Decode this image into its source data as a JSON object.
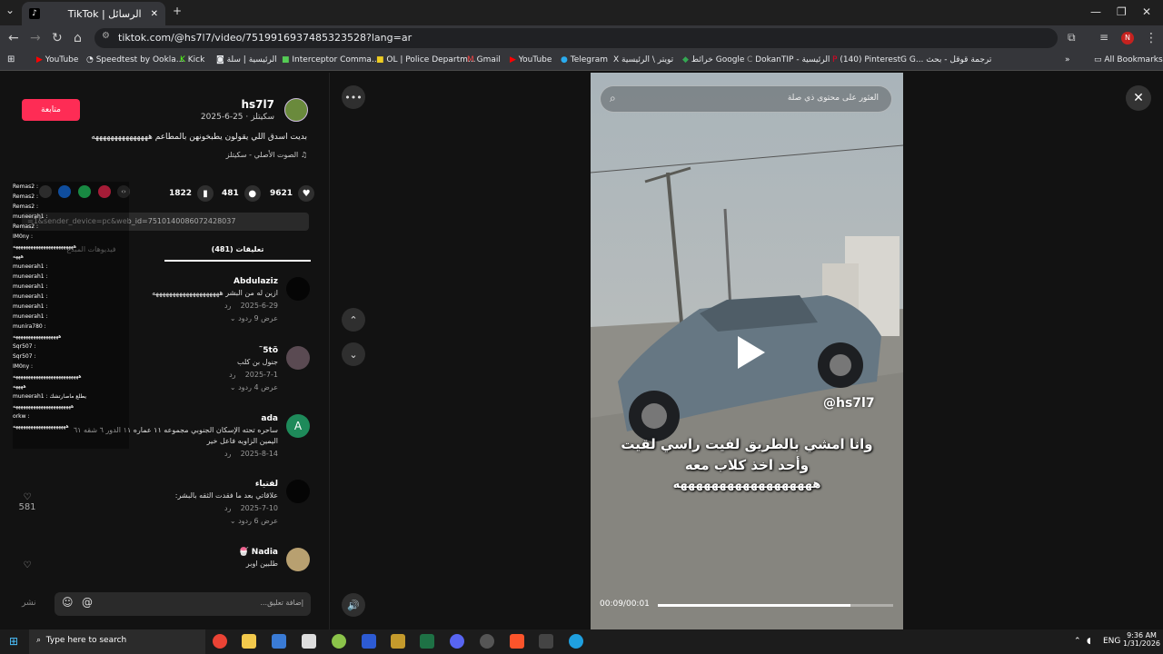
{
  "browser": {
    "tab_title": "TikTok | الرسائل",
    "url": "tiktok.com/@hs7l7/video/7519916937485323528?lang=ar",
    "bookmarks": [
      "YouTube",
      "Speedtest by Ookla...",
      "Kick",
      "الرئيسية | سلة",
      "Interceptor Comma...",
      "OL | Police Departm...",
      "Gmail",
      "YouTube",
      "Telegram",
      "تويتر \\ الرئيسية",
      "خرائط Google",
      "DokanTIP - الرئيسية",
      "(140) Pinterest",
      "G... ترجمة قوقل - بحث"
    ],
    "all_bookmarks": "All Bookmarks",
    "profile_initial": "N"
  },
  "post": {
    "follow_label": "متابعة",
    "username": "hs7l7",
    "date_line": "سكيتلز · 25-6-2025",
    "description": "بديت اسدق اللي يقولون يطبخونهن بالمطاعم هههههههههههههههه",
    "sound": "الصوت الأصلي - سكيتلز",
    "likes": "9621",
    "comments": "481",
    "saves": "1822",
    "link_text": "=1&sender_device=pc&web_id=7510140086072428037",
    "tab_comments": "تعليقات (481)",
    "tab_creator": "فيديوهات المبدع"
  },
  "comments": [
    {
      "name": "Abdulaziz",
      "text": "ازين له من البشر ههههههههههههههههههههه",
      "date": "2025-6-29",
      "reply": "رد",
      "more": "عرض 9 ردود"
    },
    {
      "name": "5tõ˜",
      "text": "جنول بن كلب",
      "date": "2025-7-1",
      "reply": "رد",
      "more": "عرض 4 ردود"
    },
    {
      "name": "ada",
      "text": "ساحره تحته الإسكان الجنوبي مجموعه ١١ عماره ١١ الدور ٦ شقه ٦١",
      "text2": "اليمين الزاويه فاعل خير",
      "date": "2025-8-14",
      "reply": "رد",
      "more": ""
    },
    {
      "name": "لفتياء",
      "text": "علاقاتي بعد ما فقدت الثقه بالبشر:",
      "date": "2025-7-10",
      "reply": "رد",
      "more": "عرض 6 ردود"
    },
    {
      "name": "Nadia 🍧",
      "text": "طلبين اوبر",
      "date": "",
      "reply": "",
      "more": ""
    }
  ],
  "side_likes": [
    "581"
  ],
  "overlay_lines": [
    "Remas2 :",
    "Remas2 :",
    "Remas2 :",
    "muneerah1 :",
    "Remas2 :",
    "IM0ny :",
    "ههههههههههههههههههههههههه",
    "هههه",
    "muneerah1 :",
    "muneerah1 :",
    "muneerah1 :",
    "muneerah1 :",
    "muneerah1 :",
    "muneerah1 :",
    "munira780 :",
    "ههههههههههههههههههه",
    "Sqr507 :",
    "Sqr507 :",
    "IM0ny :",
    "ههههههههههههههههههههههههههه",
    "ههههه",
    "muneerah1 : يطلع ماصارتشك",
    "هههههههههههههههههههههههه",
    "orkw :",
    "هههههههههههههههههههههه"
  ],
  "comment_input": {
    "placeholder": "إضافة تعليق...",
    "post_label": "نشر"
  },
  "video": {
    "search_placeholder": "العثور على محتوى ذي صلة",
    "watermark": "@hs7l7",
    "caption_1": "وانا امشي بالطريق لفيت راسي لقيت",
    "caption_2": "وأحد اخذ كلاب معه",
    "caption_3": "ههههههههههههههههههه",
    "time": "00:09/00:01",
    "progress": 0.82
  },
  "taskbar": {
    "search": "Type here to search",
    "lang": "ENG",
    "time": "9:36 AM",
    "date": "1/31/2026"
  }
}
